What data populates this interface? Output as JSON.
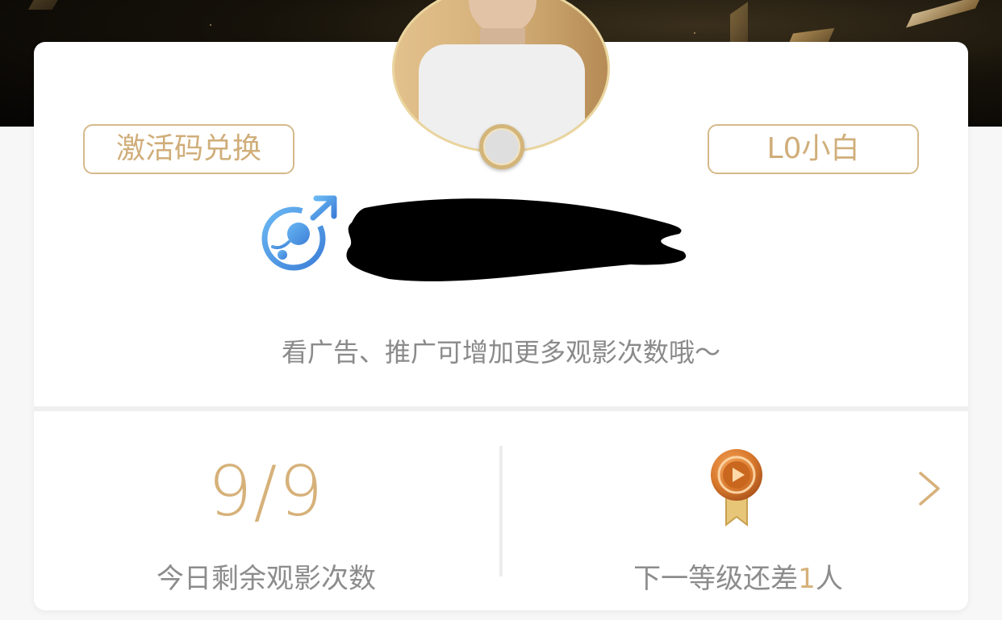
{
  "header": {
    "activate_label": "激活码兑换",
    "level_badge": "L0小白"
  },
  "profile": {
    "gender_icon": "male-icon",
    "gender_color": "#4a90e2",
    "name_redacted": true,
    "tip": "看广告、推广可增加更多观影次数哦～"
  },
  "stats": {
    "views_value": "9/9",
    "views_label": "今日剩余观影次数",
    "next_level_prefix": "下一等级还差",
    "next_level_count": "1",
    "next_level_suffix": "人",
    "medal_icon": "medal-icon"
  },
  "colors": {
    "accent_gold": "#d6b17a",
    "text_gray": "#8c8c8c"
  }
}
